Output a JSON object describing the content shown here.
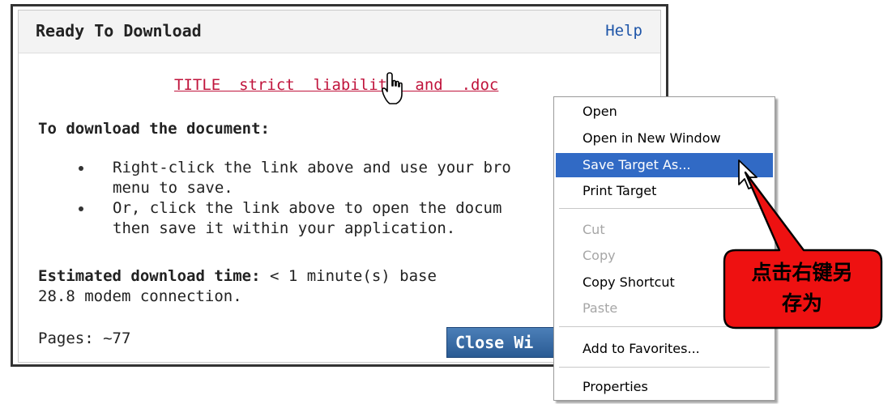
{
  "dialog": {
    "title": "Ready To Download",
    "help_label": "Help",
    "document_link": "TITLE  strict  liability  and  .doc",
    "instructions_title": "To download the document:",
    "bullets": [
      "Right-click the link above and use your bro\nmenu to save.",
      "Or, click the link above to open the docum\nthen save it within your application."
    ],
    "estimate_label": "Estimated download time:",
    "estimate_value": " < 1 minute(s) base\n28.8 modem connection.",
    "pages_text": "Pages: ~77",
    "close_button_label": "Close Wi"
  },
  "context_menu": {
    "items": [
      {
        "label": "Open",
        "state": "normal"
      },
      {
        "label": "Open in New Window",
        "state": "normal"
      },
      {
        "label": "Save Target As...",
        "state": "selected"
      },
      {
        "label": "Print Target",
        "state": "normal"
      },
      {
        "label": "Cut",
        "state": "disabled"
      },
      {
        "label": "Copy",
        "state": "disabled"
      },
      {
        "label": "Copy Shortcut",
        "state": "normal"
      },
      {
        "label": "Paste",
        "state": "disabled"
      },
      {
        "label": "Add to Favorites...",
        "state": "normal"
      },
      {
        "label": "Properties",
        "state": "normal"
      }
    ]
  },
  "callout": {
    "line1": "点击右键另",
    "line2": "存为",
    "color": "#ee1111"
  },
  "colors": {
    "link": "#c0143c",
    "help": "#1e55a8",
    "menu_selected": "#316ac5",
    "close_button": "#2a5b94"
  },
  "icons": {
    "hand_cursor": "hand-pointer-icon",
    "arrow_cursor": "arrow-pointer-icon"
  }
}
